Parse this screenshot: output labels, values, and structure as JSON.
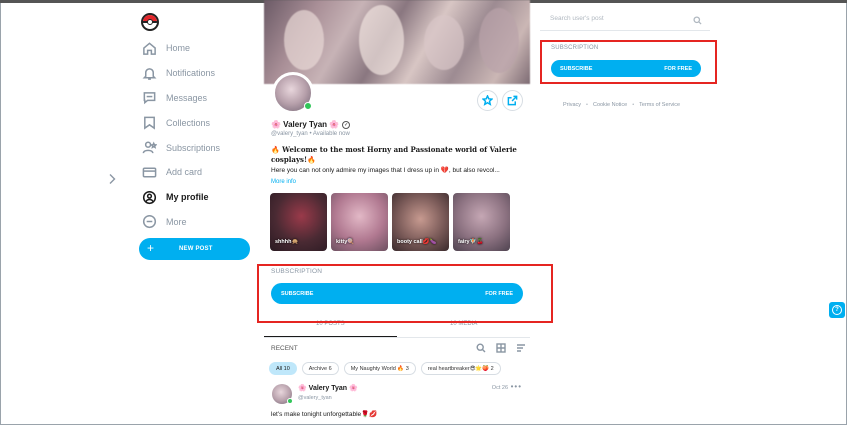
{
  "sidebar": {
    "logo": "pokeball-logo",
    "items": [
      {
        "label": "Home",
        "icon": "home-icon",
        "active": false
      },
      {
        "label": "Notifications",
        "icon": "bell-icon",
        "active": false
      },
      {
        "label": "Messages",
        "icon": "message-icon",
        "active": false
      },
      {
        "label": "Collections",
        "icon": "bookmark-icon",
        "active": false
      },
      {
        "label": "Subscriptions",
        "icon": "user-star-icon",
        "active": false
      },
      {
        "label": "Add card",
        "icon": "card-icon",
        "active": false
      },
      {
        "label": "My profile",
        "icon": "profile-icon",
        "active": true
      },
      {
        "label": "More",
        "icon": "more-icon",
        "active": false
      }
    ],
    "new_post_label": "NEW POST"
  },
  "profile": {
    "name": "🌸 Valery Tyan 🌸",
    "handle": "@valery_tyan",
    "status": "Available now",
    "handle_line": "@valery_tyan  •  Available now",
    "bio_line1": "🔥 Welcome to the most Horny and Passionate world of Valerie cosplays!🔥",
    "bio_line2": "Here you can not only admire my images that I dress up in 💔, but also revcol...",
    "more_info": "More info",
    "highlights": [
      {
        "caption": "shhhh🙊"
      },
      {
        "caption": "kitty🍭"
      },
      {
        "caption": "booty call💋🍆"
      },
      {
        "caption": "fairy🧚🏻🍒"
      }
    ]
  },
  "subscription_main": {
    "label": "SUBSCRIPTION",
    "button_left": "SUBSCRIBE",
    "button_right": "FOR FREE"
  },
  "tabs": {
    "posts": "10 POSTS",
    "media": "10 MEDIA"
  },
  "feed": {
    "recent_label": "RECENT",
    "chips": [
      {
        "label": "All 10",
        "active": true
      },
      {
        "label": "Archive 6",
        "active": false
      },
      {
        "label": "My Naughty World 🔥 3",
        "active": false
      },
      {
        "label": "real heartbreaker😎🌟🍑 2",
        "active": false
      }
    ],
    "post": {
      "name": "🌸 Valery Tyan 🌸",
      "handle": "@valery_tyan",
      "date": "Oct 26",
      "more": "•••",
      "text": "let's make tonight unforgettable🌹💋"
    }
  },
  "right": {
    "search_placeholder": "Search user's post",
    "subscription_label": "SUBSCRIPTION",
    "button_left": "SUBSCRIBE",
    "button_right": "FOR FREE",
    "footer": [
      "Privacy",
      "Cookie Notice",
      "Terms of Service"
    ],
    "help": "?"
  },
  "colors": {
    "accent": "#00aff0",
    "highlight_box": "#e52521",
    "muted": "#8a96a3",
    "online": "#32c65a"
  }
}
